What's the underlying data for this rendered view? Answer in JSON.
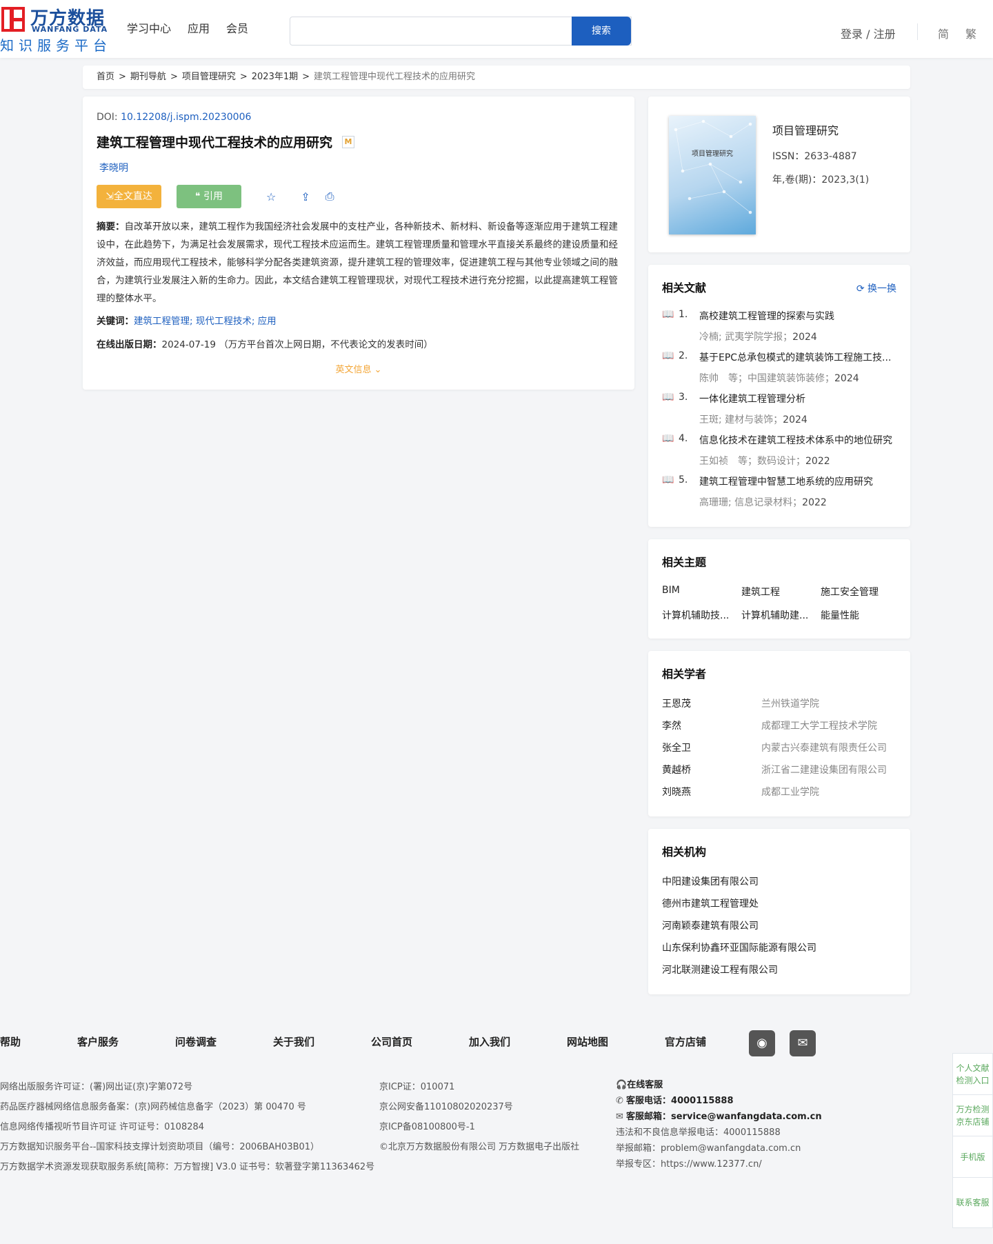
{
  "header": {
    "logo_cn": "万方数据",
    "logo_en": "WANFANG DATA",
    "logo_sub": "知识服务平台",
    "nav": [
      "学习中心",
      "应用",
      "会员"
    ],
    "search_placeholder": "",
    "search_label": "搜索",
    "login_label": "登录 / 注册",
    "lang_simplified": "简",
    "lang_traditional": "繁"
  },
  "breadcrumb": {
    "items": [
      "首页",
      "期刊导航",
      "项目管理研究",
      "2023年1期"
    ],
    "current": "建筑工程管理中现代工程技术的应用研究",
    "separator": ">"
  },
  "article": {
    "doi_label": "DOI: ",
    "doi": "10.12208/j.ispm.20230006",
    "title": "建筑工程管理中现代工程技术的应用研究",
    "badge": "M",
    "author": "李晓明",
    "fulltext_label": "全文直达",
    "cite_label": "引用",
    "abstract_label": "摘要：",
    "abstract": "自改革开放以来，建筑工程作为我国经济社会发展中的支柱产业，各种新技术、新材料、新设备等逐渐应用于建筑工程建设中，在此趋势下，为满足社会发展需求，现代工程技术应运而生。建筑工程管理质量和管理水平直接关系最终的建设质量和经济效益，而应用现代工程技术，能够科学分配各类建筑资源，提升建筑工程的管理效率，促进建筑工程与其他专业领域之间的融合，为建筑行业发展注入新的生命力。因此，本文结合建筑工程管理现状，对现代工程技术进行充分挖掘，以此提高建筑工程管理的整体水平。",
    "keywords_label": "关键词：",
    "keywords": [
      "建筑工程管理",
      "现代工程技术",
      "应用"
    ],
    "date_label": "在线出版日期：",
    "date": "2024-07-19",
    "date_note": "（万方平台首次上网日期，不代表论文的发表时间）",
    "en_info_label": "英文信息"
  },
  "journal": {
    "cover_title": "项目管理研究",
    "name": "项目管理研究",
    "issn": "ISSN：2633-4887",
    "issue": "年,卷(期)：2023,3(1)"
  },
  "related_docs": {
    "title": "相关文献",
    "refresh_label": "换一换",
    "items": [
      {
        "num": "1.",
        "title": "高校建筑工程管理的探索与实践",
        "meta": "冷楠; 武夷学院学报；",
        "year": "2024"
      },
      {
        "num": "2.",
        "title": "基于EPC总承包模式的建筑装饰工程施工技...",
        "meta": "陈帅　等；中国建筑装饰装修；",
        "year": "2024"
      },
      {
        "num": "3.",
        "title": "一体化建筑工程管理分析",
        "meta": "王斑; 建材与装饰；",
        "year": "2024"
      },
      {
        "num": "4.",
        "title": "信息化技术在建筑工程技术体系中的地位研究",
        "meta": "王如祯　等；数码设计；",
        "year": "2022"
      },
      {
        "num": "5.",
        "title": "建筑工程管理中智慧工地系统的应用研究",
        "meta": "高珊珊; 信息记录材料；",
        "year": "2022"
      }
    ]
  },
  "related_topics": {
    "title": "相关主题",
    "items": [
      "BIM",
      "建筑工程",
      "施工安全管理",
      "计算机辅助技...",
      "计算机辅助建...",
      "能量性能"
    ]
  },
  "related_scholars": {
    "title": "相关学者",
    "items": [
      {
        "name": "王恩茂",
        "org": "兰州铁道学院"
      },
      {
        "name": "李然",
        "org": "成都理工大学工程技术学院"
      },
      {
        "name": "张全卫",
        "org": "内蒙古兴泰建筑有限责任公司"
      },
      {
        "name": "黄越桥",
        "org": "浙江省二建建设集团有限公司"
      },
      {
        "name": "刘晓燕",
        "org": "成都工业学院"
      }
    ]
  },
  "related_institutions": {
    "title": "相关机构",
    "items": [
      "中阳建设集团有限公司",
      "德州市建筑工程管理处",
      "河南颖泰建筑有限公司",
      "山东保利协鑫环亚国际能源有限公司",
      "河北联测建设工程有限公司"
    ]
  },
  "footer": {
    "links": [
      "帮助",
      "客户服务",
      "问卷调查",
      "关于我们",
      "公司首页",
      "加入我们",
      "网站地图",
      "官方店铺"
    ],
    "col1": [
      "网络出版服务许可证：(署)网出证(京)字第072号",
      "药品医疗器械网络信息服务备案：(京)网药械信息备字（2023）第 00470 号",
      "信息网络传播视听节目许可证 许可证号：0108284",
      "万方数据知识服务平台--国家科技支撑计划资助项目（编号：2006BAH03B01）",
      "万方数据学术资源发现获取服务系统[简称：万方智搜] V3.0 证书号：软著登字第11363462号"
    ],
    "col2": [
      "京ICP证：010071",
      "京公网安备11010802020237号",
      "京ICP备08100800号-1",
      "©北京万方数据股份有限公司 万方数据电子出版社"
    ],
    "service_online": "在线客服",
    "service_phone_label": "客服电话：",
    "service_phone": "4000115888",
    "service_email_label": "客服邮箱：",
    "service_email": "service@wanfangdata.com.cn",
    "report_phone": "违法和不良信息举报电话：4000115888",
    "report_email": "举报邮箱：problem@wanfangdata.com.cn",
    "report_zone": "举报专区：https://www.12377.cn/"
  },
  "side": {
    "items": [
      "个人文献检测入口",
      "万方检测京东店铺",
      "手机版",
      "联系客服"
    ]
  },
  "colors": {
    "brand_blue": "#1d5fbf",
    "logo_red": "#e31e24",
    "fulltext_orange": "#f3b23c",
    "cite_green": "#7dc17f"
  }
}
